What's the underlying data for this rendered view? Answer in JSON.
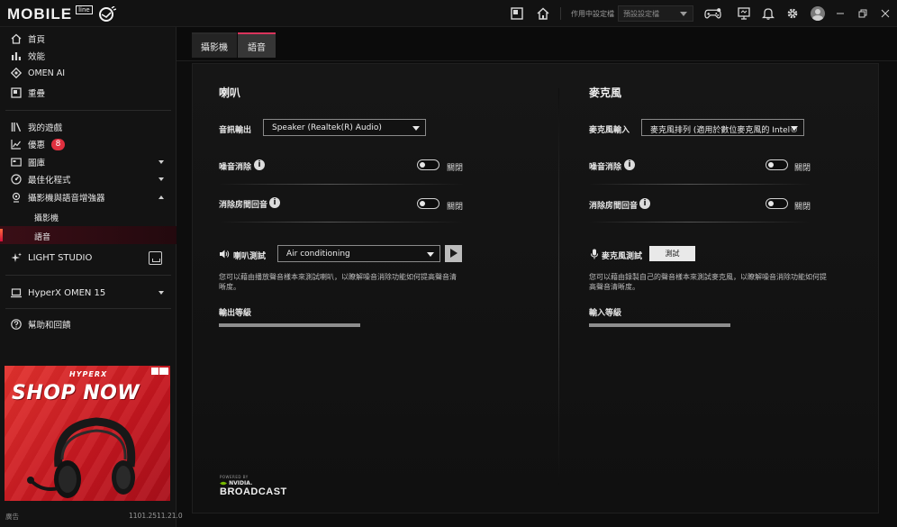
{
  "app": {
    "brand": "MOBILE",
    "brand_sub": "line",
    "profile_label": "作用中設定檔",
    "profile_value": "預設設定檔"
  },
  "sidebar": {
    "items": [
      {
        "label": "首頁",
        "icon": "home-icon"
      },
      {
        "label": "效能",
        "icon": "chart-bars-icon"
      },
      {
        "label": "OMEN AI",
        "icon": "diamond-icon"
      },
      {
        "label": "重疊",
        "icon": "overlay-icon"
      },
      {
        "label": "我的遊戲",
        "icon": "library-icon"
      },
      {
        "label": "優惠",
        "icon": "trend-icon",
        "badge": "8"
      },
      {
        "label": "圖庫",
        "icon": "gallery-icon"
      },
      {
        "label": "最佳化程式",
        "icon": "optimizer-icon"
      },
      {
        "label": "攝影機與語音增強器",
        "icon": "camera-icon"
      }
    ],
    "sub_items": [
      {
        "label": "攝影機"
      },
      {
        "label": "語音"
      }
    ],
    "light_studio": "LIGHT STUDIO",
    "device": "HyperX OMEN 15",
    "help": "幫助和回饋",
    "status": "廣告",
    "version": "1101.2511.21.0"
  },
  "ad": {
    "brand": "HYPERX",
    "headline": "SHOP NOW"
  },
  "tabs": [
    {
      "label": "攝影機",
      "active": false
    },
    {
      "label": "語音",
      "active": true
    }
  ],
  "speaker": {
    "title": "喇叭",
    "output_label": "音訊輸出",
    "output_value": "Speaker (Realtek(R) Audio)",
    "noise_label": "噪音消除",
    "noise_state": "關閉",
    "echo_label": "消除房間回音",
    "echo_state": "關閉",
    "test_label": "喇叭測試",
    "test_value": "Air conditioning",
    "test_desc_1": "您可以藉由播放聲音樣本來測試喇叭，以瞭解噪音消除功能如何提高聲音清",
    "test_desc_2": "晰度。",
    "level_label": "輸出等級"
  },
  "mic": {
    "title": "麥克風",
    "input_label": "麥克風輸入",
    "input_value": "麥克風排列 (適用於數位麥克風的 Intel®",
    "noise_label": "噪音消除",
    "noise_state": "關閉",
    "echo_label": "消除房間回音",
    "echo_state": "關閉",
    "test_label": "麥克風測試",
    "test_button": "測試",
    "test_desc_1": "您可以藉由錄製自己的聲音樣本來測試麥克風，以瞭解噪音消除功能如何提",
    "test_desc_2": "高聲音清晰度。",
    "level_label": "輸入等級"
  },
  "footer": {
    "powered_by": "POWERED BY",
    "nvidia": "NVIDIA.",
    "broadcast": "BROADCAST"
  }
}
